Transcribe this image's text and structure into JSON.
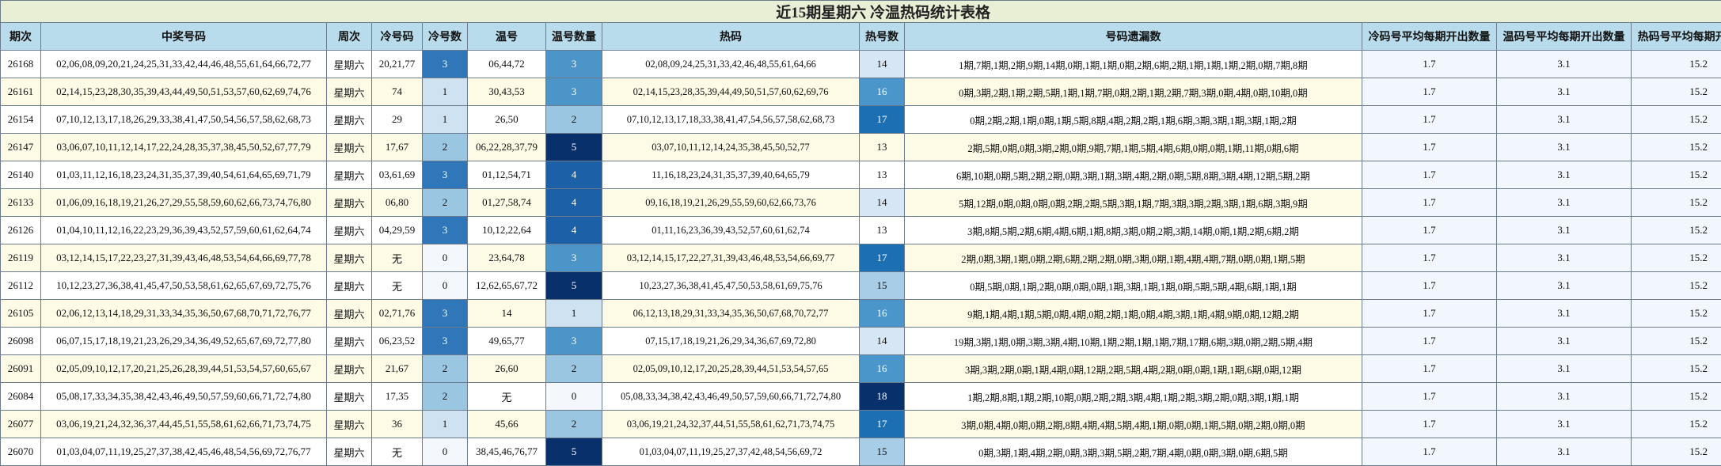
{
  "title": "近15期星期六 冷温热码统计表格",
  "headers": [
    "期次",
    "中奖号码",
    "周次",
    "冷号码",
    "冷号数",
    "温号",
    "温号数量",
    "热码",
    "热号数",
    "号码遗漏数",
    "冷码号平均每期开出数量",
    "温码号平均每期开出数量",
    "热码号平均每期开出数量"
  ],
  "rows": [
    {
      "period": "26168",
      "numbers": "02,06,08,09,20,21,24,25,31,33,42,44,46,48,55,61,64,66,72,77",
      "week": "星期六",
      "cold": "20,21,77",
      "cold_count": "3",
      "warm": "06,44,72",
      "warm_count": "3",
      "hot": "02,08,09,24,25,31,33,42,46,48,55,61,64,66",
      "hot_count": "14",
      "miss": "1期,7期,1期,2期,9期,14期,0期,1期,1期,0期,2期,6期,2期,1期,1期,1期,2期,0期,7期,8期",
      "avg_cold": "1.7",
      "avg_warm": "3.1",
      "avg_hot": "15.2"
    },
    {
      "period": "26161",
      "numbers": "02,14,15,23,28,30,35,39,43,44,49,50,51,53,57,60,62,69,74,76",
      "week": "星期六",
      "cold": "74",
      "cold_count": "1",
      "warm": "30,43,53",
      "warm_count": "3",
      "hot": "02,14,15,23,28,35,39,44,49,50,51,57,60,62,69,76",
      "hot_count": "16",
      "miss": "0期,3期,2期,1期,2期,5期,1期,1期,7期,0期,2期,1期,2期,7期,3期,0期,4期,0期,10期,0期",
      "avg_cold": "1.7",
      "avg_warm": "3.1",
      "avg_hot": "15.2"
    },
    {
      "period": "26154",
      "numbers": "07,10,12,13,17,18,26,29,33,38,41,47,50,54,56,57,58,62,68,73",
      "week": "星期六",
      "cold": "29",
      "cold_count": "1",
      "warm": "26,50",
      "warm_count": "2",
      "hot": "07,10,12,13,17,18,33,38,41,47,54,56,57,58,62,68,73",
      "hot_count": "17",
      "miss": "0期,2期,2期,1期,0期,1期,5期,8期,4期,2期,2期,1期,6期,3期,3期,1期,3期,1期,2期",
      "avg_cold": "1.7",
      "avg_warm": "3.1",
      "avg_hot": "15.2"
    },
    {
      "period": "26147",
      "numbers": "03,06,07,10,11,12,14,17,22,24,28,35,37,38,45,50,52,67,77,79",
      "week": "星期六",
      "cold": "17,67",
      "cold_count": "2",
      "warm": "06,22,28,37,79",
      "warm_count": "5",
      "hot": "03,07,10,11,12,14,24,35,38,45,50,52,77",
      "hot_count": "13",
      "miss": "2期,5期,0期,0期,3期,2期,0期,9期,7期,1期,5期,4期,6期,0期,0期,1期,11期,0期,6期",
      "avg_cold": "1.7",
      "avg_warm": "3.1",
      "avg_hot": "15.2"
    },
    {
      "period": "26140",
      "numbers": "01,03,11,12,16,18,23,24,31,35,37,39,40,54,61,64,65,69,71,79",
      "week": "星期六",
      "cold": "03,61,69",
      "cold_count": "3",
      "warm": "01,12,54,71",
      "warm_count": "4",
      "hot": "11,16,18,23,24,31,35,37,39,40,64,65,79",
      "hot_count": "13",
      "miss": "6期,10期,0期,5期,2期,2期,0期,3期,1期,3期,4期,2期,0期,5期,8期,3期,4期,12期,5期,2期",
      "avg_cold": "1.7",
      "avg_warm": "3.1",
      "avg_hot": "15.2"
    },
    {
      "period": "26133",
      "numbers": "01,06,09,16,18,19,21,26,27,29,55,58,59,60,62,66,73,74,76,80",
      "week": "星期六",
      "cold": "06,80",
      "cold_count": "2",
      "warm": "01,27,58,74",
      "warm_count": "4",
      "hot": "09,16,18,19,21,26,29,55,59,60,62,66,73,76",
      "hot_count": "14",
      "miss": "5期,12期,0期,0期,0期,0期,2期,2期,5期,3期,1期,7期,3期,3期,2期,3期,1期,6期,3期,9期",
      "avg_cold": "1.7",
      "avg_warm": "3.1",
      "avg_hot": "15.2"
    },
    {
      "period": "26126",
      "numbers": "01,04,10,11,12,16,22,23,29,36,39,43,52,57,59,60,61,62,64,74",
      "week": "星期六",
      "cold": "04,29,59",
      "cold_count": "3",
      "warm": "10,12,22,64",
      "warm_count": "4",
      "hot": "01,11,16,23,36,39,43,52,57,60,61,62,74",
      "hot_count": "13",
      "miss": "3期,8期,5期,2期,6期,4期,6期,1期,8期,3期,0期,2期,3期,14期,0期,1期,2期,6期,2期",
      "avg_cold": "1.7",
      "avg_warm": "3.1",
      "avg_hot": "15.2"
    },
    {
      "period": "26119",
      "numbers": "03,12,14,15,17,22,23,27,31,39,43,46,48,53,54,64,66,69,77,78",
      "week": "星期六",
      "cold": "无",
      "cold_count": "0",
      "warm": "23,64,78",
      "warm_count": "3",
      "hot": "03,12,14,15,17,22,27,31,39,43,46,48,53,54,66,69,77",
      "hot_count": "17",
      "miss": "2期,0期,3期,1期,0期,2期,6期,2期,2期,0期,3期,0期,1期,4期,4期,7期,0期,0期,1期,5期",
      "avg_cold": "1.7",
      "avg_warm": "3.1",
      "avg_hot": "15.2"
    },
    {
      "period": "26112",
      "numbers": "10,12,23,27,36,38,41,45,47,50,53,58,61,62,65,67,69,72,75,76",
      "week": "星期六",
      "cold": "无",
      "cold_count": "0",
      "warm": "12,62,65,67,72",
      "warm_count": "5",
      "hot": "10,23,27,36,38,41,45,47,50,53,58,61,69,75,76",
      "hot_count": "15",
      "miss": "0期,5期,0期,1期,2期,0期,0期,0期,1期,3期,1期,1期,0期,5期,5期,4期,6期,1期,1期",
      "avg_cold": "1.7",
      "avg_warm": "3.1",
      "avg_hot": "15.2"
    },
    {
      "period": "26105",
      "numbers": "02,06,12,13,14,18,29,31,33,34,35,36,50,67,68,70,71,72,76,77",
      "week": "星期六",
      "cold": "02,71,76",
      "cold_count": "3",
      "warm": "14",
      "warm_count": "1",
      "hot": "06,12,13,18,29,31,33,34,35,36,50,67,68,70,72,77",
      "hot_count": "16",
      "miss": "9期,1期,4期,1期,5期,0期,4期,0期,2期,1期,0期,4期,3期,1期,4期,9期,0期,12期,2期",
      "avg_cold": "1.7",
      "avg_warm": "3.1",
      "avg_hot": "15.2"
    },
    {
      "period": "26098",
      "numbers": "06,07,15,17,18,19,21,23,26,29,34,36,49,52,65,67,69,72,77,80",
      "week": "星期六",
      "cold": "06,23,52",
      "cold_count": "3",
      "warm": "49,65,77",
      "warm_count": "3",
      "hot": "07,15,17,18,19,21,26,29,34,36,67,69,72,80",
      "hot_count": "14",
      "miss": "19期,3期,1期,0期,3期,3期,4期,10期,1期,2期,1期,1期,7期,17期,6期,3期,0期,2期,5期,4期",
      "avg_cold": "1.7",
      "avg_warm": "3.1",
      "avg_hot": "15.2"
    },
    {
      "period": "26091",
      "numbers": "02,05,09,10,12,17,20,21,25,26,28,39,44,51,53,54,57,60,65,67",
      "week": "星期六",
      "cold": "21,67",
      "cold_count": "2",
      "warm": "26,60",
      "warm_count": "2",
      "hot": "02,05,09,10,12,17,20,25,28,39,44,51,53,54,57,65",
      "hot_count": "16",
      "miss": "3期,3期,2期,0期,1期,4期,0期,12期,2期,5期,4期,2期,0期,0期,1期,1期,6期,0期,12期",
      "avg_cold": "1.7",
      "avg_warm": "3.1",
      "avg_hot": "15.2"
    },
    {
      "period": "26084",
      "numbers": "05,08,17,33,34,35,38,42,43,46,49,50,57,59,60,66,71,72,74,80",
      "week": "星期六",
      "cold": "17,35",
      "cold_count": "2",
      "warm": "无",
      "warm_count": "0",
      "hot": "05,08,33,34,38,42,43,46,49,50,57,59,60,66,71,72,74,80",
      "hot_count": "18",
      "miss": "1期,2期,8期,1期,2期,10期,0期,2期,2期,3期,4期,1期,2期,3期,2期,0期,3期,1期,1期",
      "avg_cold": "1.7",
      "avg_warm": "3.1",
      "avg_hot": "15.2"
    },
    {
      "period": "26077",
      "numbers": "03,06,19,21,24,32,36,37,44,45,51,55,58,61,62,66,71,73,74,75",
      "week": "星期六",
      "cold": "36",
      "cold_count": "1",
      "warm": "45,66",
      "warm_count": "2",
      "hot": "03,06,19,21,24,32,37,44,51,55,58,61,62,71,73,74,75",
      "hot_count": "17",
      "miss": "3期,0期,4期,0期,0期,2期,8期,4期,4期,5期,4期,1期,0期,0期,1期,5期,0期,2期,0期,0期",
      "avg_cold": "1.7",
      "avg_warm": "3.1",
      "avg_hot": "15.2"
    },
    {
      "period": "26070",
      "numbers": "01,03,04,07,11,19,25,27,37,38,42,45,46,48,54,56,69,72,76,77",
      "week": "星期六",
      "cold": "无",
      "cold_count": "0",
      "warm": "38,45,46,76,77",
      "warm_count": "5",
      "hot": "01,03,04,07,11,19,25,27,37,42,48,54,56,69,72",
      "hot_count": "15",
      "miss": "0期,3期,1期,4期,2期,0期,3期,3期,5期,2期,7期,4期,0期,0期,3期,0期,6期,5期",
      "avg_cold": "1.7",
      "avg_warm": "3.1",
      "avg_hot": "15.2"
    }
  ]
}
